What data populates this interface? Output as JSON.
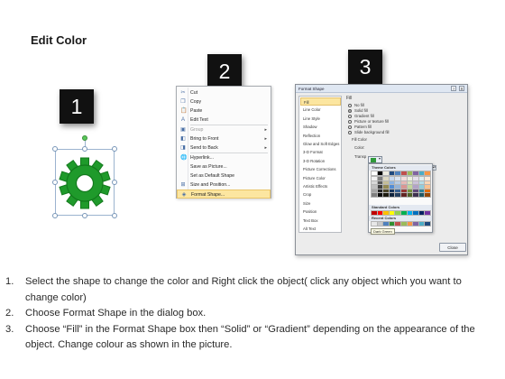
{
  "title": "Edit Color",
  "badges": [
    "1",
    "2",
    "3"
  ],
  "context_menu": {
    "items": [
      {
        "icon": "scissors-icon",
        "glyph": "✂",
        "label": "Cut",
        "dim": false,
        "arrow": false
      },
      {
        "icon": "copy-icon",
        "glyph": "❐",
        "label": "Copy",
        "dim": false,
        "arrow": false
      },
      {
        "icon": "paste-icon",
        "glyph": "📋",
        "label": "Paste",
        "dim": false,
        "arrow": false
      },
      {
        "icon": "edit-text-icon",
        "glyph": "A",
        "label": "Edit Text",
        "dim": false,
        "arrow": false
      },
      {
        "icon": "group-icon",
        "glyph": "▣",
        "label": "Group",
        "dim": true,
        "arrow": true
      },
      {
        "icon": "bring-front-icon",
        "glyph": "◧",
        "label": "Bring to Front",
        "dim": false,
        "arrow": true
      },
      {
        "icon": "send-back-icon",
        "glyph": "◨",
        "label": "Send to Back",
        "dim": false,
        "arrow": true
      },
      {
        "icon": "hyperlink-icon",
        "glyph": "🌐",
        "label": "Hyperlink...",
        "dim": false,
        "arrow": false
      },
      {
        "icon": "save-picture-icon",
        "glyph": "",
        "label": "Save as Picture...",
        "dim": false,
        "arrow": false
      },
      {
        "icon": "default-shape-icon",
        "glyph": "",
        "label": "Set as Default Shape",
        "dim": false,
        "arrow": false
      },
      {
        "icon": "size-position-icon",
        "glyph": "⊞",
        "label": "Size and Position...",
        "dim": false,
        "arrow": false
      },
      {
        "icon": "format-shape-icon",
        "glyph": "◈",
        "label": "Format Shape...",
        "dim": false,
        "arrow": false,
        "highlight": true
      }
    ]
  },
  "dialog": {
    "title": "Format Shape",
    "help": "?",
    "close_glyph": "X",
    "categories": [
      "Fill",
      "Line Color",
      "Line Style",
      "Shadow",
      "Reflection",
      "Glow and Soft Edges",
      "3-D Format",
      "3-D Rotation",
      "Picture Corrections",
      "Picture Color",
      "Artistic Effects",
      "Crop",
      "Size",
      "Position",
      "Text Box",
      "Alt Text"
    ],
    "selected_category": "Fill",
    "section_title": "Fill",
    "fill_options": [
      {
        "label": "No fill",
        "type": "radio",
        "on": false
      },
      {
        "label": "Solid fill",
        "type": "radio",
        "on": true
      },
      {
        "label": "Gradient fill",
        "type": "radio",
        "on": false
      },
      {
        "label": "Picture or texture fill",
        "type": "radio",
        "on": false
      },
      {
        "label": "Pattern fill",
        "type": "radio",
        "on": false
      },
      {
        "label": "Slide background fill",
        "type": "radio",
        "on": false
      }
    ],
    "fill_color_group": "Fill Color",
    "color_label": "Color:",
    "transparency_label": "Transp",
    "close_button": "Close"
  },
  "palette": {
    "theme_header": "Theme Colors",
    "standard_header": "Standard Colors",
    "recent_header": "Recent Colors",
    "more": "More Colors...",
    "tooltip": "Dark Green",
    "theme_top": [
      "#ffffff",
      "#000000",
      "#eeece1",
      "#1f497d",
      "#4f81bd",
      "#c0504d",
      "#9bbb59",
      "#8064a2",
      "#4bacc6",
      "#f79646"
    ],
    "theme_shades": [
      [
        "#f2f2f2",
        "#7f7f7f",
        "#ddd9c3",
        "#c6d9f0",
        "#dbe5f1",
        "#f2dcdb",
        "#ebf1dd",
        "#e5e0ec",
        "#dbeef3",
        "#fdeada"
      ],
      [
        "#d8d8d8",
        "#595959",
        "#c4bd97",
        "#8db3e2",
        "#b8cce4",
        "#e5b9b7",
        "#d7e3bc",
        "#ccc1d9",
        "#b7dde8",
        "#fbd5b5"
      ],
      [
        "#bfbfbf",
        "#3f3f3f",
        "#938953",
        "#548dd4",
        "#95b3d7",
        "#d99694",
        "#c3d69b",
        "#b2a2c7",
        "#92cddc",
        "#fac08f"
      ],
      [
        "#a5a5a5",
        "#262626",
        "#494429",
        "#17365d",
        "#366092",
        "#953734",
        "#76923c",
        "#5f497a",
        "#31859b",
        "#e36c09"
      ],
      [
        "#7f7f7f",
        "#0c0c0c",
        "#1d1b10",
        "#0f243e",
        "#244061",
        "#632423",
        "#4f6128",
        "#3f3151",
        "#205867",
        "#974806"
      ]
    ],
    "standard": [
      "#c00000",
      "#ff0000",
      "#ffc000",
      "#ffff00",
      "#92d050",
      "#00b050",
      "#00b0f0",
      "#0070c0",
      "#002060",
      "#7030a0"
    ],
    "recent": [
      "#e8e8e8",
      "#c9c9c9",
      "#4f81bd",
      "#2f8f2f",
      "#c0504d",
      "#9bbb59",
      "#f79646",
      "#8064a2",
      "#4bacc6",
      "#1f497d"
    ]
  },
  "steps": [
    {
      "num": "1.",
      "text": "Select the shape to change the color and Right click the object( click any object which you want to change color)"
    },
    {
      "num": "2.",
      "text": "Choose Format Shape in the dialog box."
    },
    {
      "num": "3.",
      "text": "Choose “Fill” in the Format Shape box then “Solid” or “Gradient” depending on the appearance of the object. Change colour as shown in the picture."
    }
  ],
  "colors": {
    "gear": "#1f9a2b",
    "gear_dark": "#137a1d",
    "highlight": "#fce6a0"
  }
}
